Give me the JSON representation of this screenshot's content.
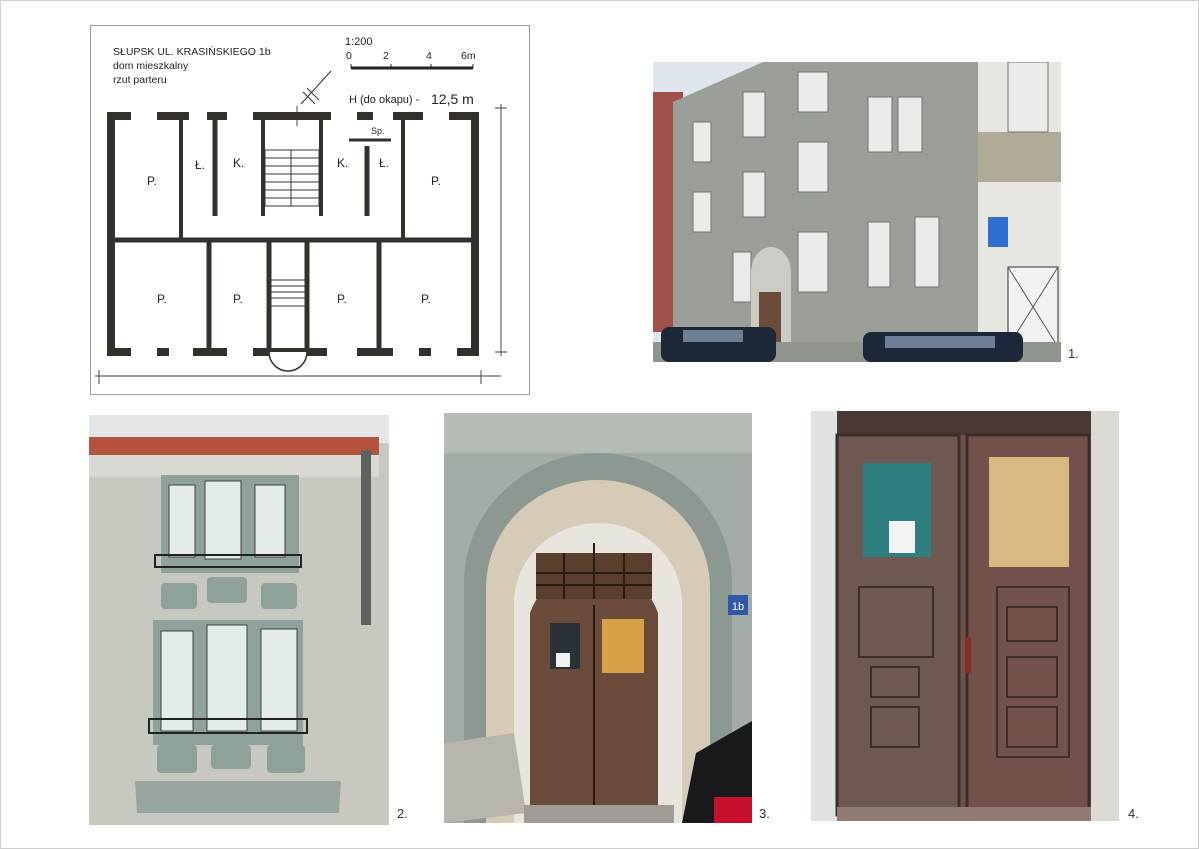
{
  "plan": {
    "title": "SŁUPSK UL. KRASIŃSKIEGO 1b",
    "subtitle": "dom mieszkalny",
    "view": "rzut parteru",
    "scale": "1:200",
    "scale_ticks": [
      "0",
      "2",
      "4",
      "6m"
    ],
    "height_label": "H (do okapu) -",
    "height_value": "12,5 m",
    "room_labels": {
      "p": "P.",
      "l": "Ł.",
      "k": "K.",
      "sp": "Sp."
    }
  },
  "photos": [
    {
      "number": "1.",
      "subject": "street facade"
    },
    {
      "number": "2.",
      "subject": "bay windows"
    },
    {
      "number": "3.",
      "subject": "arched entrance"
    },
    {
      "number": "4.",
      "subject": "wooden door"
    }
  ],
  "sign_number": "1b",
  "colors": {
    "wall": "#34302b",
    "facade": "#9ea39b",
    "door": "#6b4a3a",
    "sky": "#dfe6ee"
  }
}
